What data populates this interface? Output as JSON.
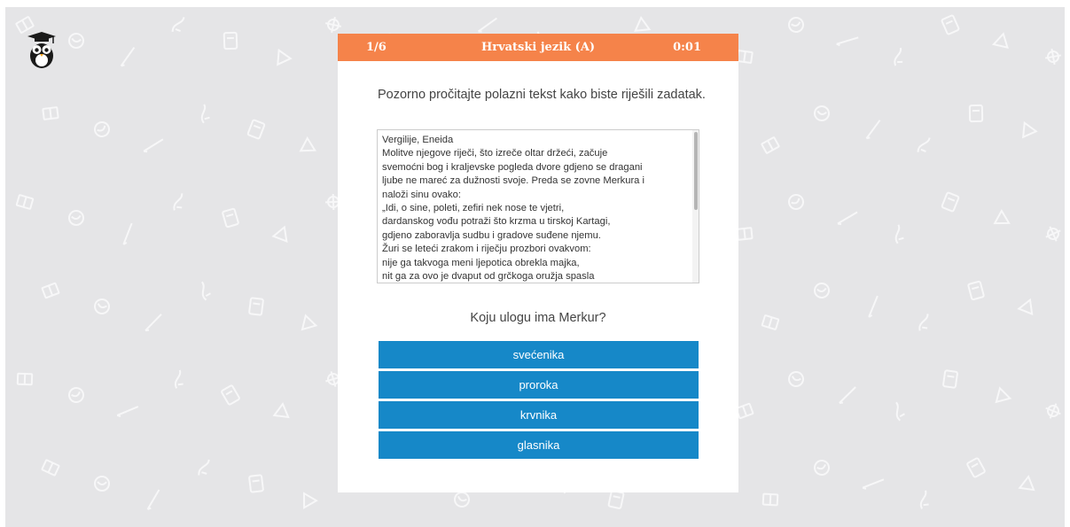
{
  "header": {
    "counter": "1/6",
    "title": "Hrvatski jezik (A)",
    "timer": "0:01"
  },
  "instruction": "Pozorno pročitajte polazni tekst kako biste riješili zadatak.",
  "passage": {
    "lines": [
      "Vergilije, Eneida",
      "Molitve njegove riječi, što izreče oltar držeći, začuje",
      "svemoćni bog i kraljevske pogleda dvore gdjeno se dragani",
      "ljube ne mareć za dužnosti svoje. Preda se zovne Merkura i",
      "naloži sinu ovako:",
      "„Idi, o sine, poleti, zefiri nek nose te vjetri,",
      "dardanskog vođu potraži što krzma u tirskoj Kartagi,",
      "gdjeno zaboravlja sudbu i gradove suđene njemu.",
      "Žuri se leteći zrakom i riječju prozbori ovakvom:",
      "nije ga takvoga meni ljepotica obrekla majka,",
      "nit ga za ovo je dvaput od grčkoga oružja spasla"
    ]
  },
  "question": "Koju ulogu ima Merkur?",
  "answers": [
    "svećenika",
    "proroka",
    "krvnika",
    "glasnika"
  ],
  "icons": [
    "owl-logo-icon",
    "scrollbar"
  ],
  "colors": {
    "header": "#f5834a",
    "answer_button": "#1688c8",
    "background": "#e5e5e7",
    "doodle": "#f7f7f8"
  }
}
